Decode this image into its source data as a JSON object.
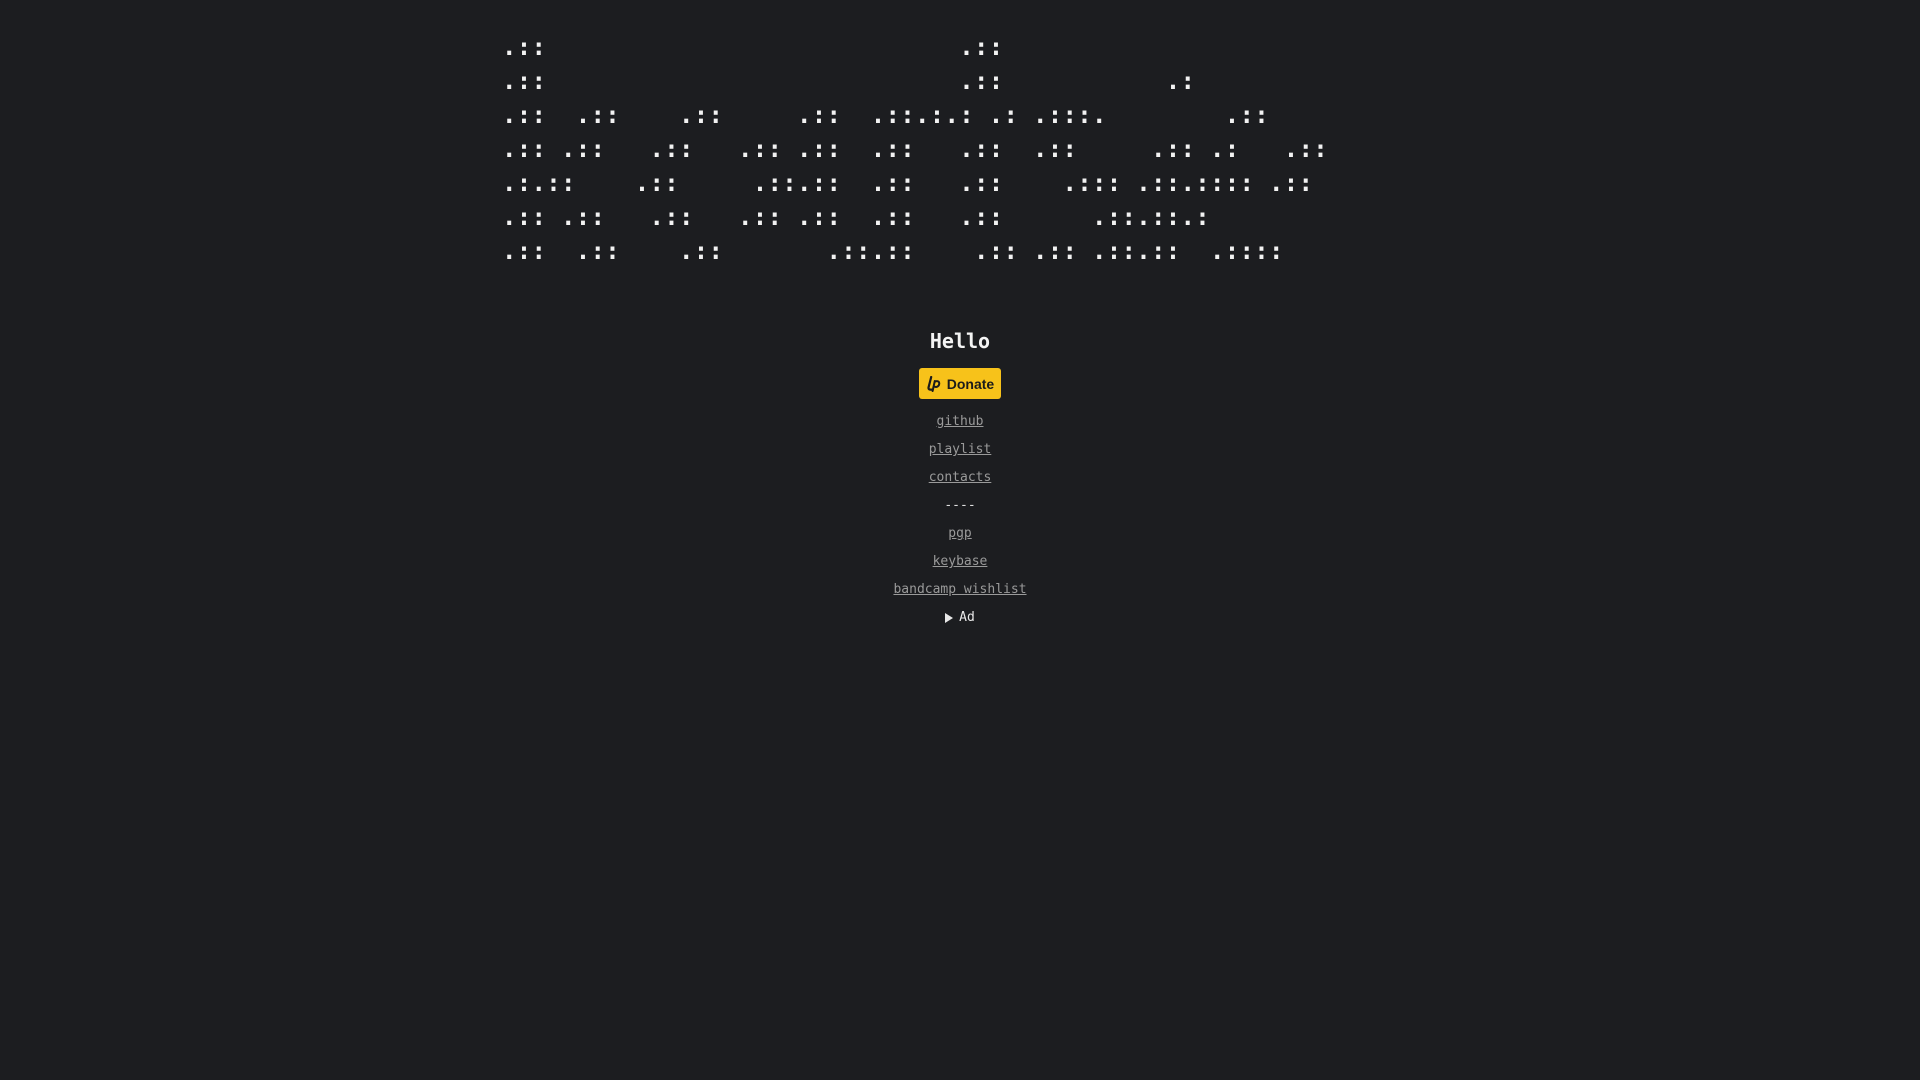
{
  "banner": {
    "ascii_lines": [
      ".::                            .::",
      ".::                            .::           .:",
      ".::  .::    .::     .::  .::.:.: .: .:::.        .::",
      ".:: .::   .::   .:: .::  .::   .::  .::     .:: .:   .::",
      ".:.::    .::     .::.::  .::   .::    .::: .::.:::: .::",
      ".:: .::   .::   .:: .::  .::   .::      .::.::.:",
      ".::  .::    .::       .::.::    .:: .:: .::.::  .::::"
    ]
  },
  "header": {
    "title": "Hello"
  },
  "donate": {
    "label": "Donate",
    "icon": "liberapay-icon",
    "bg_color": "#f7c21a"
  },
  "links": [
    {
      "label": "github"
    },
    {
      "label": "playlist"
    },
    {
      "label": "contacts"
    }
  ],
  "separator": "----",
  "links_secondary": [
    {
      "label": "pgp"
    },
    {
      "label": "keybase"
    },
    {
      "label": "bandcamp wishlist"
    }
  ],
  "details": {
    "summary": "Ad",
    "icon": "disclosure-triangle-icon"
  },
  "theme": {
    "background": "#1c1d20",
    "text": "#e6e6e6",
    "link": "#9a9a9a"
  }
}
